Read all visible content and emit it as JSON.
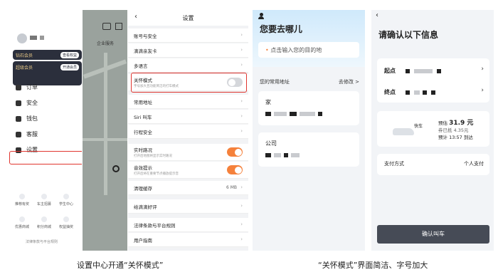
{
  "drawer": {
    "card1": {
      "title": "钻石会员",
      "action": "查看权益"
    },
    "card2": {
      "title": "超级会员",
      "action": "开通会员"
    },
    "menu": [
      "订单",
      "安全",
      "钱包",
      "客服",
      "设置"
    ],
    "grid": [
      "推荐有奖",
      "车主招募",
      "学生中心",
      "优惠商城",
      "积分商城",
      "权益抽奖"
    ],
    "footer": "法律条款与平台规则"
  },
  "map": {
    "label": "企业服务"
  },
  "settings": {
    "title": "设置",
    "rows": [
      {
        "label": "账号与安全"
      },
      {
        "label": "滴滴亲友卡"
      },
      {
        "label": "多语言"
      },
      {
        "label": "关怀模式",
        "sub": "字号加大且功能简洁的打车模式"
      },
      {
        "label": "常用地址"
      },
      {
        "label": "Siri 叫车"
      },
      {
        "label": "行程安全"
      },
      {
        "label": "实时路况",
        "sub": "打开后地图将显示实时路况"
      },
      {
        "label": "音效提示",
        "sub": "打开后将在重要节点播放提示音"
      },
      {
        "label": "清理缓存",
        "value": "6 MB"
      },
      {
        "label": "给滴滴好评"
      },
      {
        "label": "法律条款与平台规则"
      },
      {
        "label": "用户指南"
      }
    ]
  },
  "care": {
    "title": "您要去哪儿",
    "search_placeholder": "点击输入您的目的地",
    "dot": "•",
    "frequent": "您的常用地址",
    "edit": "去修改 >",
    "home": "家",
    "company": "公司"
  },
  "confirm": {
    "title": "请确认以下信息",
    "start": "起点",
    "end": "终点",
    "ride_type": "快车",
    "estimate_label": "预估",
    "estimate_value": "31.9 元",
    "discount": "券已抵 4.35元",
    "arrival": "预计 13:57 到达",
    "pay_label": "支付方式",
    "pay_value": "个人支付",
    "button": "确认叫车"
  },
  "captions": {
    "left": "设置中心开通“关怀模式”",
    "right": "“关怀模式”界面简洁、字号加大"
  },
  "colors": {
    "highlight": "#e0352f",
    "toggle_on": "#f5813b",
    "button": "#464b56"
  }
}
